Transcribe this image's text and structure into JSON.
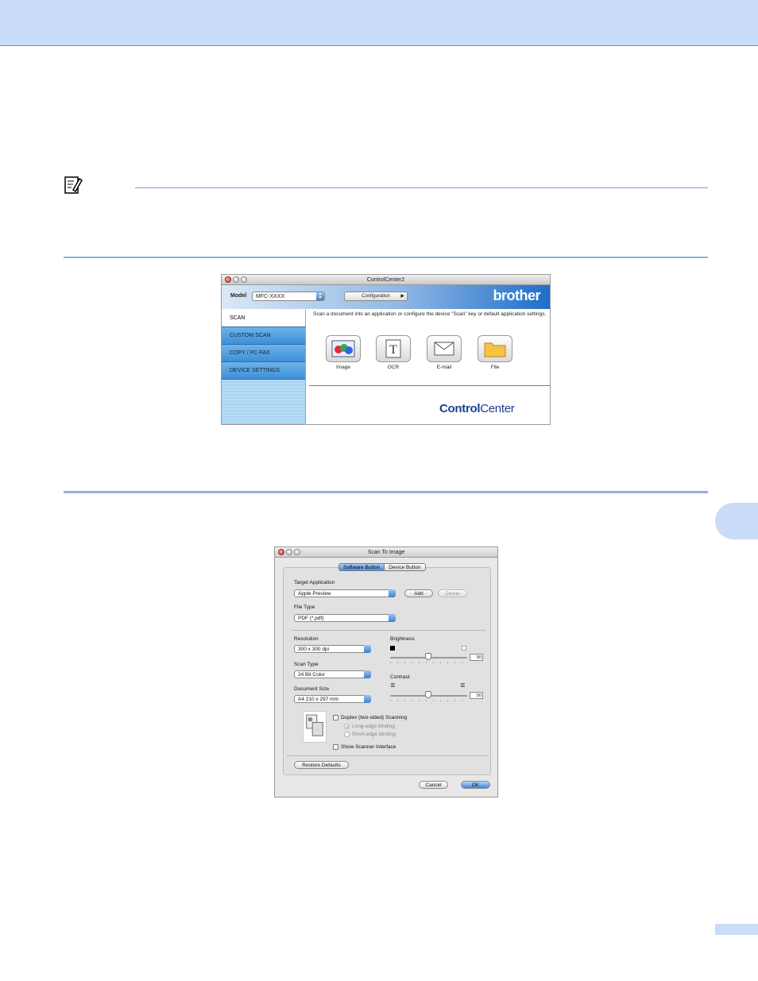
{
  "controlcenter": {
    "title": "ControlCenter2",
    "model_label": "Model",
    "model_value": "MFC-XXXX",
    "configuration_label": "Configuration",
    "brand_logo": "brother",
    "tabs": [
      "SCAN",
      "CUSTOM SCAN",
      "COPY / PC-FAX",
      "DEVICE SETTINGS"
    ],
    "active_tab": "SCAN",
    "description": "Scan a document into an application or configure the device \"Scan\" key or default application settings.",
    "icons": [
      {
        "label": "Image",
        "icon": "image-icon"
      },
      {
        "label": "OCR",
        "icon": "ocr-icon"
      },
      {
        "label": "E-mail",
        "icon": "email-icon"
      },
      {
        "label": "File",
        "icon": "folder-icon"
      }
    ],
    "logo_bold": "Control",
    "logo_light": "Center"
  },
  "scan_dialog": {
    "title": "Scan To Image",
    "tab_software": "Software Button",
    "tab_device": "Device Button",
    "target_app_label": "Target Application",
    "target_app_value": "Apple Preview",
    "add_label": "Add",
    "delete_label": "Delete",
    "file_type_label": "File Type",
    "file_type_value": "PDF (*.pdf)",
    "resolution_label": "Resolution",
    "resolution_value": "300 x 300 dpi",
    "scan_type_label": "Scan Type",
    "scan_type_value": "24 Bit Color",
    "doc_size_label": "Document Size",
    "doc_size_value": "A4  210 x 297 mm",
    "brightness_label": "Brightness",
    "brightness_value": "50",
    "contrast_label": "Contrast",
    "contrast_value": "50",
    "duplex_label": "Duplex (two-sided) Scanning",
    "long_edge_label": "Long-edge binding",
    "short_edge_label": "Short-edge binding",
    "show_scanner_label": "Show Scanner Interface",
    "restore_label": "Restore Defaults",
    "cancel_label": "Cancel",
    "ok_label": "OK"
  }
}
